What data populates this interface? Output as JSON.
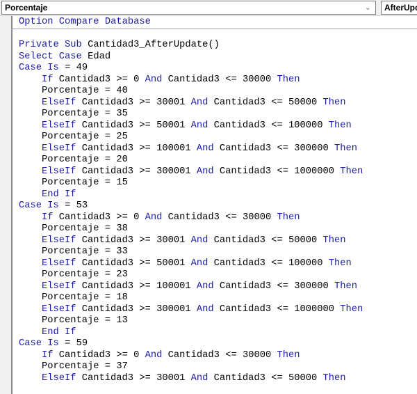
{
  "toolbar": {
    "object_combo": "Porcentaje",
    "procedure_combo": "AfterUpdate"
  },
  "keywords": [
    "Option",
    "Compare",
    "Database",
    "Private",
    "Sub",
    "Select",
    "Case",
    "Is",
    "If",
    "And",
    "Then",
    "ElseIf",
    "End"
  ],
  "code_lines": [
    "Option Compare Database",
    "",
    "Private Sub Cantidad3_AfterUpdate()",
    "Select Case Edad",
    "Case Is = 49",
    "    If Cantidad3 >= 0 And Cantidad3 <= 30000 Then",
    "    Porcentaje = 40",
    "    ElseIf Cantidad3 >= 30001 And Cantidad3 <= 50000 Then",
    "    Porcentaje = 35",
    "    ElseIf Cantidad3 >= 50001 And Cantidad3 <= 100000 Then",
    "    Porcentaje = 25",
    "    ElseIf Cantidad3 >= 100001 And Cantidad3 <= 300000 Then",
    "    Porcentaje = 20",
    "    ElseIf Cantidad3 >= 300001 And Cantidad3 <= 1000000 Then",
    "    Porcentaje = 15",
    "    End If",
    "Case Is = 53",
    "    If Cantidad3 >= 0 And Cantidad3 <= 30000 Then",
    "    Porcentaje = 38",
    "    ElseIf Cantidad3 >= 30001 And Cantidad3 <= 50000 Then",
    "    Porcentaje = 33",
    "    ElseIf Cantidad3 >= 50001 And Cantidad3 <= 100000 Then",
    "    Porcentaje = 23",
    "    ElseIf Cantidad3 >= 100001 And Cantidad3 <= 300000 Then",
    "    Porcentaje = 18",
    "    ElseIf Cantidad3 >= 300001 And Cantidad3 <= 1000000 Then",
    "    Porcentaje = 13",
    "    End If",
    "Case Is = 59",
    "    If Cantidad3 >= 0 And Cantidad3 <= 30000 Then",
    "    Porcentaje = 37",
    "    ElseIf Cantidad3 >= 30001 And Cantidad3 <= 50000 Then"
  ]
}
